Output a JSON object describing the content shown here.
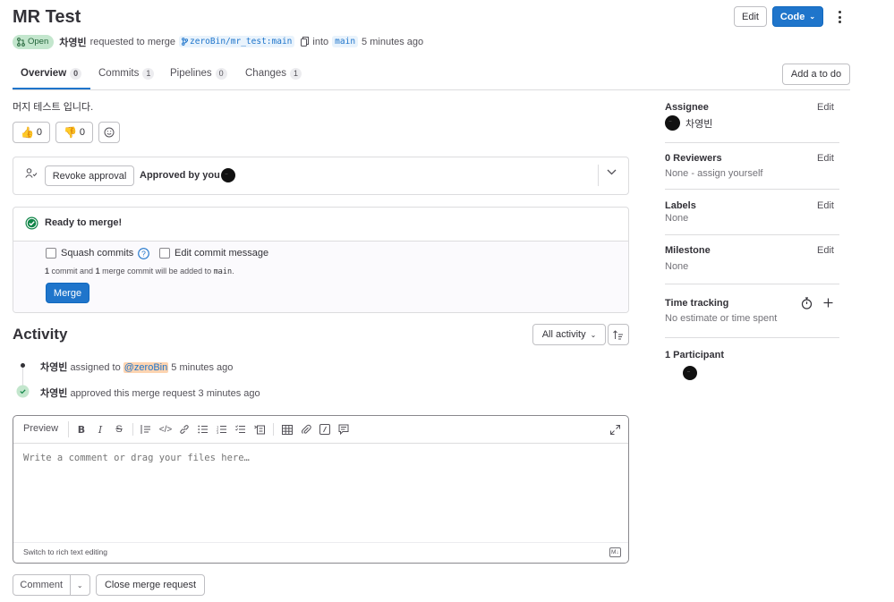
{
  "header": {
    "title": "MR Test",
    "edit_label": "Edit",
    "code_label": "Code",
    "status": "Open",
    "author": "차영빈",
    "requested_text": "requested to merge",
    "source_branch": "zeroBin/mr_test:main",
    "into_text": "into",
    "target_branch": "main",
    "time": "5 minutes ago"
  },
  "tabs": [
    {
      "label": "Overview",
      "count": "0"
    },
    {
      "label": "Commits",
      "count": "1"
    },
    {
      "label": "Pipelines",
      "count": "0"
    },
    {
      "label": "Changes",
      "count": "1"
    }
  ],
  "add_todo_label": "Add a to do",
  "description": "머지 테스트 입니다.",
  "reactions": {
    "thumbs_up": "0",
    "thumbs_down": "0"
  },
  "approval": {
    "revoke_label": "Revoke approval",
    "approved_text": "Approved by you"
  },
  "merge": {
    "ready_text": "Ready to merge!",
    "squash_label": "Squash commits",
    "edit_msg_label": "Edit commit message",
    "commit_count": "1",
    "commit_text": "commit and",
    "merge_count": "1",
    "merge_text": "merge commit will be added to",
    "branch": "main",
    "merge_button": "Merge"
  },
  "activity": {
    "title": "Activity",
    "filter_label": "All activity",
    "items": [
      {
        "author": "차영빈",
        "text_before": "assigned to",
        "mention": "@zeroBin",
        "time": "5 minutes ago"
      },
      {
        "author": "차영빈",
        "text": "approved this merge request 3 minutes ago"
      }
    ]
  },
  "comment_box": {
    "preview_label": "Preview",
    "placeholder": "Write a comment or drag your files here…",
    "switch_text": "Switch to rich text editing",
    "md_badge": "M↓",
    "comment_button": "Comment",
    "close_button": "Close merge request"
  },
  "sidebar": {
    "assignee": {
      "title": "Assignee",
      "edit": "Edit",
      "name": "차영빈"
    },
    "reviewers": {
      "title": "0 Reviewers",
      "edit": "Edit",
      "value": "None - assign yourself"
    },
    "labels": {
      "title": "Labels",
      "edit": "Edit",
      "value": "None"
    },
    "milestone": {
      "title": "Milestone",
      "edit": "Edit",
      "value": "None"
    },
    "time_tracking": {
      "title": "Time tracking",
      "value": "No estimate or time spent"
    },
    "participants": {
      "title": "1 Participant"
    }
  },
  "colors": {
    "accent": "#1f75cb",
    "success": "#108548",
    "open_bg": "#c3e6cd"
  }
}
